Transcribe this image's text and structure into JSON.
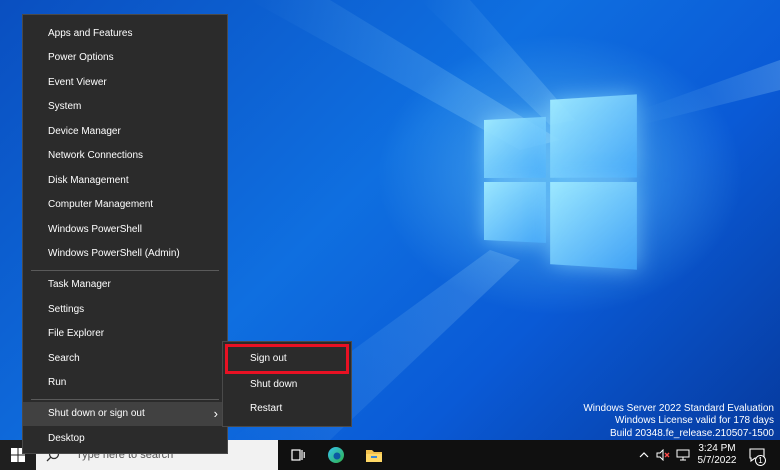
{
  "desktop": {
    "watermark": {
      "line1": "Windows Server 2022 Standard Evaluation",
      "line2": "Windows License valid for 178 days",
      "line3": "Build 20348.fe_release.210507-1500"
    }
  },
  "context_menu": {
    "items": [
      {
        "label": "Apps and Features"
      },
      {
        "label": "Power Options"
      },
      {
        "label": "Event Viewer"
      },
      {
        "label": "System"
      },
      {
        "label": "Device Manager"
      },
      {
        "label": "Network Connections"
      },
      {
        "label": "Disk Management"
      },
      {
        "label": "Computer Management"
      },
      {
        "label": "Windows PowerShell"
      },
      {
        "label": "Windows PowerShell (Admin)"
      },
      {
        "label": "Task Manager"
      },
      {
        "label": "Settings"
      },
      {
        "label": "File Explorer"
      },
      {
        "label": "Search"
      },
      {
        "label": "Run"
      },
      {
        "label": "Shut down or sign out"
      },
      {
        "label": "Desktop"
      }
    ],
    "expand_glyph": "›"
  },
  "submenu": {
    "items": [
      {
        "label": "Sign out"
      },
      {
        "label": "Shut down"
      },
      {
        "label": "Restart"
      }
    ],
    "highlight_color": "#e81123"
  },
  "taskbar": {
    "search_placeholder": "Type here to search",
    "clock_time": "3:24 PM",
    "clock_date": "5/7/2022",
    "notification_count": "1",
    "icons": [
      "windows-start-icon",
      "search-icon",
      "task-view-icon",
      "edge-icon",
      "file-explorer-icon",
      "chevron-up-icon",
      "speaker-muted-icon",
      "network-icon",
      "notification-icon"
    ]
  }
}
